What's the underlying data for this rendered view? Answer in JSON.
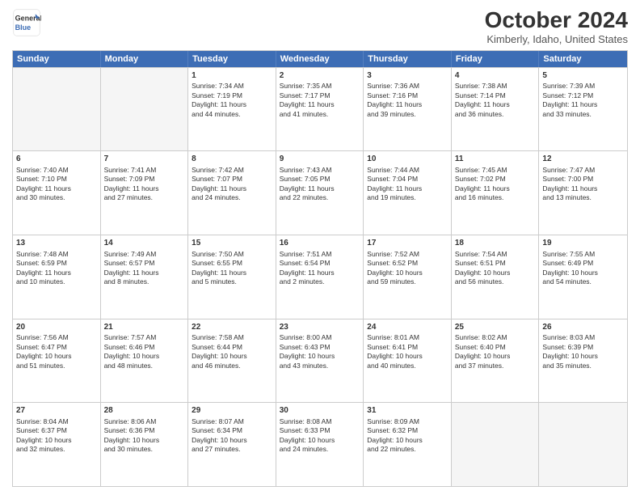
{
  "logo": {
    "line1": "General",
    "line2": "Blue"
  },
  "title": "October 2024",
  "subtitle": "Kimberly, Idaho, United States",
  "headers": [
    "Sunday",
    "Monday",
    "Tuesday",
    "Wednesday",
    "Thursday",
    "Friday",
    "Saturday"
  ],
  "rows": [
    [
      {
        "day": "",
        "empty": true
      },
      {
        "day": "",
        "empty": true
      },
      {
        "day": "1",
        "line1": "Sunrise: 7:34 AM",
        "line2": "Sunset: 7:19 PM",
        "line3": "Daylight: 11 hours",
        "line4": "and 44 minutes."
      },
      {
        "day": "2",
        "line1": "Sunrise: 7:35 AM",
        "line2": "Sunset: 7:17 PM",
        "line3": "Daylight: 11 hours",
        "line4": "and 41 minutes."
      },
      {
        "day": "3",
        "line1": "Sunrise: 7:36 AM",
        "line2": "Sunset: 7:16 PM",
        "line3": "Daylight: 11 hours",
        "line4": "and 39 minutes."
      },
      {
        "day": "4",
        "line1": "Sunrise: 7:38 AM",
        "line2": "Sunset: 7:14 PM",
        "line3": "Daylight: 11 hours",
        "line4": "and 36 minutes."
      },
      {
        "day": "5",
        "line1": "Sunrise: 7:39 AM",
        "line2": "Sunset: 7:12 PM",
        "line3": "Daylight: 11 hours",
        "line4": "and 33 minutes."
      }
    ],
    [
      {
        "day": "6",
        "line1": "Sunrise: 7:40 AM",
        "line2": "Sunset: 7:10 PM",
        "line3": "Daylight: 11 hours",
        "line4": "and 30 minutes."
      },
      {
        "day": "7",
        "line1": "Sunrise: 7:41 AM",
        "line2": "Sunset: 7:09 PM",
        "line3": "Daylight: 11 hours",
        "line4": "and 27 minutes."
      },
      {
        "day": "8",
        "line1": "Sunrise: 7:42 AM",
        "line2": "Sunset: 7:07 PM",
        "line3": "Daylight: 11 hours",
        "line4": "and 24 minutes."
      },
      {
        "day": "9",
        "line1": "Sunrise: 7:43 AM",
        "line2": "Sunset: 7:05 PM",
        "line3": "Daylight: 11 hours",
        "line4": "and 22 minutes."
      },
      {
        "day": "10",
        "line1": "Sunrise: 7:44 AM",
        "line2": "Sunset: 7:04 PM",
        "line3": "Daylight: 11 hours",
        "line4": "and 19 minutes."
      },
      {
        "day": "11",
        "line1": "Sunrise: 7:45 AM",
        "line2": "Sunset: 7:02 PM",
        "line3": "Daylight: 11 hours",
        "line4": "and 16 minutes."
      },
      {
        "day": "12",
        "line1": "Sunrise: 7:47 AM",
        "line2": "Sunset: 7:00 PM",
        "line3": "Daylight: 11 hours",
        "line4": "and 13 minutes."
      }
    ],
    [
      {
        "day": "13",
        "line1": "Sunrise: 7:48 AM",
        "line2": "Sunset: 6:59 PM",
        "line3": "Daylight: 11 hours",
        "line4": "and 10 minutes."
      },
      {
        "day": "14",
        "line1": "Sunrise: 7:49 AM",
        "line2": "Sunset: 6:57 PM",
        "line3": "Daylight: 11 hours",
        "line4": "and 8 minutes."
      },
      {
        "day": "15",
        "line1": "Sunrise: 7:50 AM",
        "line2": "Sunset: 6:55 PM",
        "line3": "Daylight: 11 hours",
        "line4": "and 5 minutes."
      },
      {
        "day": "16",
        "line1": "Sunrise: 7:51 AM",
        "line2": "Sunset: 6:54 PM",
        "line3": "Daylight: 11 hours",
        "line4": "and 2 minutes."
      },
      {
        "day": "17",
        "line1": "Sunrise: 7:52 AM",
        "line2": "Sunset: 6:52 PM",
        "line3": "Daylight: 10 hours",
        "line4": "and 59 minutes."
      },
      {
        "day": "18",
        "line1": "Sunrise: 7:54 AM",
        "line2": "Sunset: 6:51 PM",
        "line3": "Daylight: 10 hours",
        "line4": "and 56 minutes."
      },
      {
        "day": "19",
        "line1": "Sunrise: 7:55 AM",
        "line2": "Sunset: 6:49 PM",
        "line3": "Daylight: 10 hours",
        "line4": "and 54 minutes."
      }
    ],
    [
      {
        "day": "20",
        "line1": "Sunrise: 7:56 AM",
        "line2": "Sunset: 6:47 PM",
        "line3": "Daylight: 10 hours",
        "line4": "and 51 minutes."
      },
      {
        "day": "21",
        "line1": "Sunrise: 7:57 AM",
        "line2": "Sunset: 6:46 PM",
        "line3": "Daylight: 10 hours",
        "line4": "and 48 minutes."
      },
      {
        "day": "22",
        "line1": "Sunrise: 7:58 AM",
        "line2": "Sunset: 6:44 PM",
        "line3": "Daylight: 10 hours",
        "line4": "and 46 minutes."
      },
      {
        "day": "23",
        "line1": "Sunrise: 8:00 AM",
        "line2": "Sunset: 6:43 PM",
        "line3": "Daylight: 10 hours",
        "line4": "and 43 minutes."
      },
      {
        "day": "24",
        "line1": "Sunrise: 8:01 AM",
        "line2": "Sunset: 6:41 PM",
        "line3": "Daylight: 10 hours",
        "line4": "and 40 minutes."
      },
      {
        "day": "25",
        "line1": "Sunrise: 8:02 AM",
        "line2": "Sunset: 6:40 PM",
        "line3": "Daylight: 10 hours",
        "line4": "and 37 minutes."
      },
      {
        "day": "26",
        "line1": "Sunrise: 8:03 AM",
        "line2": "Sunset: 6:39 PM",
        "line3": "Daylight: 10 hours",
        "line4": "and 35 minutes."
      }
    ],
    [
      {
        "day": "27",
        "line1": "Sunrise: 8:04 AM",
        "line2": "Sunset: 6:37 PM",
        "line3": "Daylight: 10 hours",
        "line4": "and 32 minutes."
      },
      {
        "day": "28",
        "line1": "Sunrise: 8:06 AM",
        "line2": "Sunset: 6:36 PM",
        "line3": "Daylight: 10 hours",
        "line4": "and 30 minutes."
      },
      {
        "day": "29",
        "line1": "Sunrise: 8:07 AM",
        "line2": "Sunset: 6:34 PM",
        "line3": "Daylight: 10 hours",
        "line4": "and 27 minutes."
      },
      {
        "day": "30",
        "line1": "Sunrise: 8:08 AM",
        "line2": "Sunset: 6:33 PM",
        "line3": "Daylight: 10 hours",
        "line4": "and 24 minutes."
      },
      {
        "day": "31",
        "line1": "Sunrise: 8:09 AM",
        "line2": "Sunset: 6:32 PM",
        "line3": "Daylight: 10 hours",
        "line4": "and 22 minutes."
      },
      {
        "day": "",
        "empty": true
      },
      {
        "day": "",
        "empty": true
      }
    ]
  ]
}
